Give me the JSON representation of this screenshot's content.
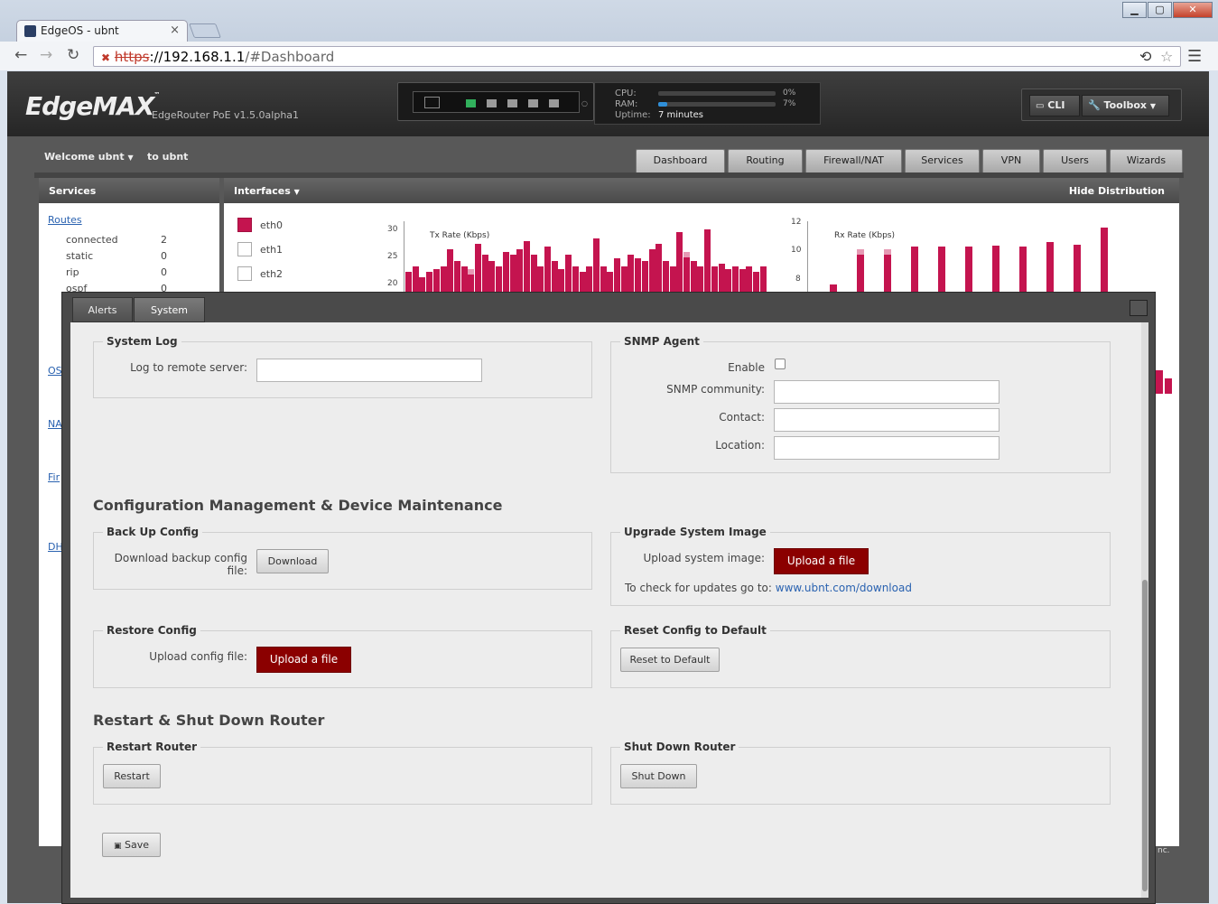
{
  "browser": {
    "tab_title": "EdgeOS - ubnt",
    "url_scheme": "https",
    "url_host": "://192.168.1.1",
    "url_path": "/#Dashboard",
    "tab_close": "×"
  },
  "header": {
    "logo": "EdgeMAX",
    "logo_mark": "™",
    "model": "EdgeRouter PoE v1.5.0alpha1",
    "cpu_label": "CPU:",
    "cpu_value": "0%",
    "cpu_fraction": 0.0,
    "ram_label": "RAM:",
    "ram_value": "7%",
    "ram_fraction": 0.07,
    "uptime_label": "Uptime:",
    "uptime_value": "7 minutes",
    "cli_label": "CLI",
    "toolbox_label": "Toolbox"
  },
  "nav": {
    "welcome": "Welcome ubnt",
    "to_user": "to ubnt",
    "tabs": [
      "Dashboard",
      "Routing",
      "Firewall/NAT",
      "Services",
      "VPN",
      "Users",
      "Wizards"
    ],
    "active_tab": "Dashboard"
  },
  "services": {
    "title": "Services",
    "routes_link": "Routes",
    "rows": [
      {
        "label": "connected",
        "value": "2"
      },
      {
        "label": "static",
        "value": "0"
      },
      {
        "label": "rip",
        "value": "0"
      },
      {
        "label": "ospf",
        "value": "0"
      }
    ],
    "links": [
      "OS",
      "NA",
      "Fir",
      "DH"
    ]
  },
  "interfaces": {
    "title": "Interfaces",
    "hide_distribution": "Hide Distribution",
    "items": [
      {
        "name": "eth0",
        "checked": true
      },
      {
        "name": "eth1",
        "checked": false
      },
      {
        "name": "eth2",
        "checked": false
      }
    ],
    "accent_color": "#c4144f"
  },
  "chart_data": [
    {
      "type": "bar",
      "title": "Tx Rate (Kbps)",
      "yticks": [
        "30",
        "25",
        "20"
      ],
      "ylim": [
        17.5,
        30
      ],
      "values": [
        21,
        22,
        20,
        21,
        21.5,
        22,
        25,
        23,
        22,
        21.5,
        26,
        24,
        23,
        22,
        24.5,
        24,
        25,
        26.5,
        24,
        22,
        25.5,
        23,
        21.5,
        24,
        22,
        21,
        22,
        27,
        22,
        21,
        23.5,
        22,
        24,
        23.5,
        23,
        25,
        26,
        23,
        22,
        28,
        24.5,
        23,
        22,
        28.5,
        22,
        22.5,
        21.5,
        22,
        21.5,
        22,
        21,
        22
      ],
      "peaks": [
        9,
        40
      ]
    },
    {
      "type": "bar",
      "title": "Rx Rate (Kbps)",
      "yticks": [
        "12",
        "10",
        "8"
      ],
      "ylim": [
        7,
        12.5
      ],
      "values": [
        7.6,
        10.3,
        10.3,
        10.5,
        10.5,
        10.5,
        10.6,
        10.5,
        10.9,
        10.7,
        12
      ],
      "peaks": [
        1,
        2
      ]
    }
  ],
  "modal": {
    "tabs": [
      "Alerts",
      "System"
    ],
    "active_tab": "System",
    "system_log": {
      "legend": "System Log",
      "remote_label": "Log to remote server:",
      "remote_value": ""
    },
    "snmp": {
      "legend": "SNMP Agent",
      "enable_label": "Enable",
      "enabled": false,
      "community_label": "SNMP community:",
      "contact_label": "Contact:",
      "location_label": "Location:"
    },
    "config_section": "Configuration Management & Device Maintenance",
    "backup": {
      "legend": "Back Up Config",
      "label": "Download backup config file:",
      "button": "Download"
    },
    "upgrade": {
      "legend": "Upgrade System Image",
      "label": "Upload system image:",
      "button": "Upload a file",
      "check_text": "To check for updates go to:",
      "check_link": "www.ubnt.com/download"
    },
    "restore": {
      "legend": "Restore Config",
      "label": "Upload config file:",
      "button": "Upload a file"
    },
    "reset": {
      "legend": "Reset Config to Default",
      "button": "Reset to Default"
    },
    "restart_section": "Restart & Shut Down Router",
    "restart": {
      "legend": "Restart Router",
      "button": "Restart"
    },
    "shutdown": {
      "legend": "Shut Down Router",
      "button": "Shut Down"
    },
    "save_button": "Save",
    "button_color": "#8b0000"
  },
  "footer": {
    "text": "nc."
  }
}
